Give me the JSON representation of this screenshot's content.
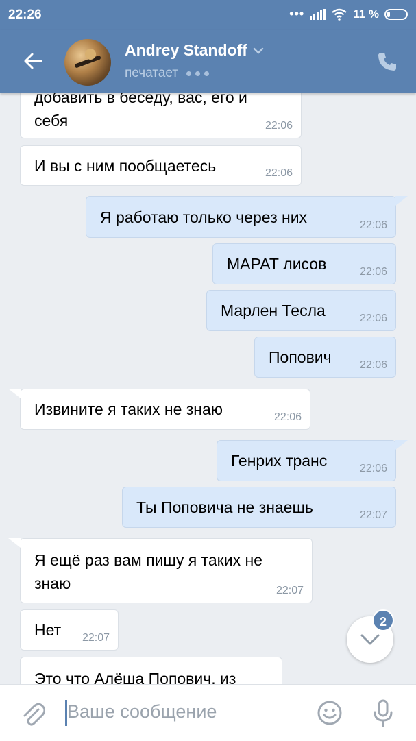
{
  "statusbar": {
    "time": "22:26",
    "dots": "•••",
    "battery": "11 %"
  },
  "header": {
    "name": "Andrey Standoff",
    "status": "печатает"
  },
  "messages": [
    {
      "dir": "in",
      "text1": "добавить в беседу, вас, его и",
      "text2": "себя",
      "time": "22:06"
    },
    {
      "dir": "in",
      "text": "И вы с ним пообщаетесь",
      "time": "22:06"
    },
    {
      "dir": "out",
      "text": "Я работаю только через них",
      "time": "22:06"
    },
    {
      "dir": "out",
      "text": "МАРАТ лисов",
      "time": "22:06"
    },
    {
      "dir": "out",
      "text": "Марлен Тесла",
      "time": "22:06"
    },
    {
      "dir": "out",
      "text": "Попович",
      "time": "22:06"
    },
    {
      "dir": "in",
      "text": "Извините я таких не знаю",
      "time": "22:06"
    },
    {
      "dir": "out",
      "text": "Генрих транс",
      "time": "22:06"
    },
    {
      "dir": "out",
      "text": "Ты Поповича не знаешь",
      "time": "22:07"
    },
    {
      "dir": "in",
      "text1": "Я ещё раз вам пишу я таких не",
      "text2": "знаю",
      "time": "22:07"
    },
    {
      "dir": "in",
      "text": "Нет",
      "time": "22:07"
    },
    {
      "dir": "in",
      "text": "Это что Алёша Попович, из"
    }
  ],
  "scroll_badge": "2",
  "composer": {
    "placeholder": "Ваше сообщение"
  },
  "colors": {
    "brand": "#5b82b1",
    "bubble_out": "#d9e8fa",
    "bubble_in": "#ffffff",
    "background": "#ebeef2"
  },
  "icons": [
    "back-arrow-icon",
    "chevron-down-icon",
    "phone-icon",
    "chevron-down-icon",
    "paperclip-icon",
    "smile-icon",
    "microphone-icon"
  ]
}
